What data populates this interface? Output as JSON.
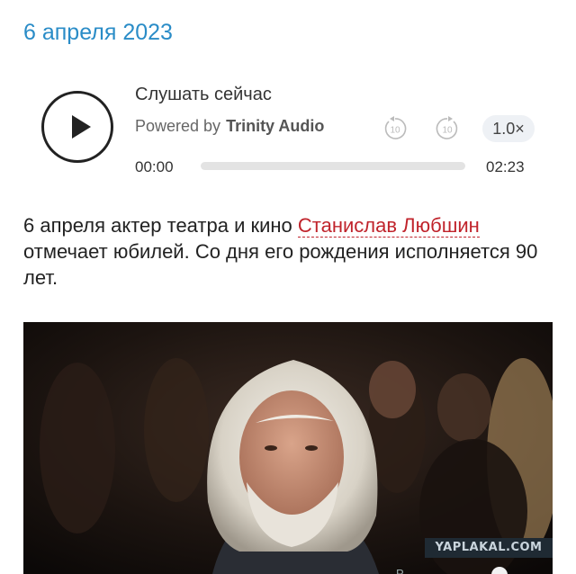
{
  "article": {
    "date": "6 апреля 2023",
    "paragraph": {
      "before": "6 апреля актер театра и кино ",
      "link": "Станислав Любшин",
      "after": " отмечает юбилей. Со дня его рождения исполняется 90 лет."
    }
  },
  "player": {
    "listen_label": "Слушать сейчас",
    "powered_by": "Powered by",
    "brand": "Trinity Audio",
    "skip_back_label": "10",
    "skip_forward_label": "10",
    "speed": "1.0×",
    "current_time": "00:00",
    "total_time": "02:23",
    "progress": 0
  },
  "image": {
    "watermark": "YAPLAKAL.COM",
    "caption_fragment": "Р..."
  },
  "colors": {
    "date": "#2a8cc7",
    "link": "#c0232b",
    "text": "#222222"
  },
  "icons": [
    "play-icon",
    "rewind-10-icon",
    "forward-10-icon",
    "close-icon",
    "info-icon"
  ]
}
